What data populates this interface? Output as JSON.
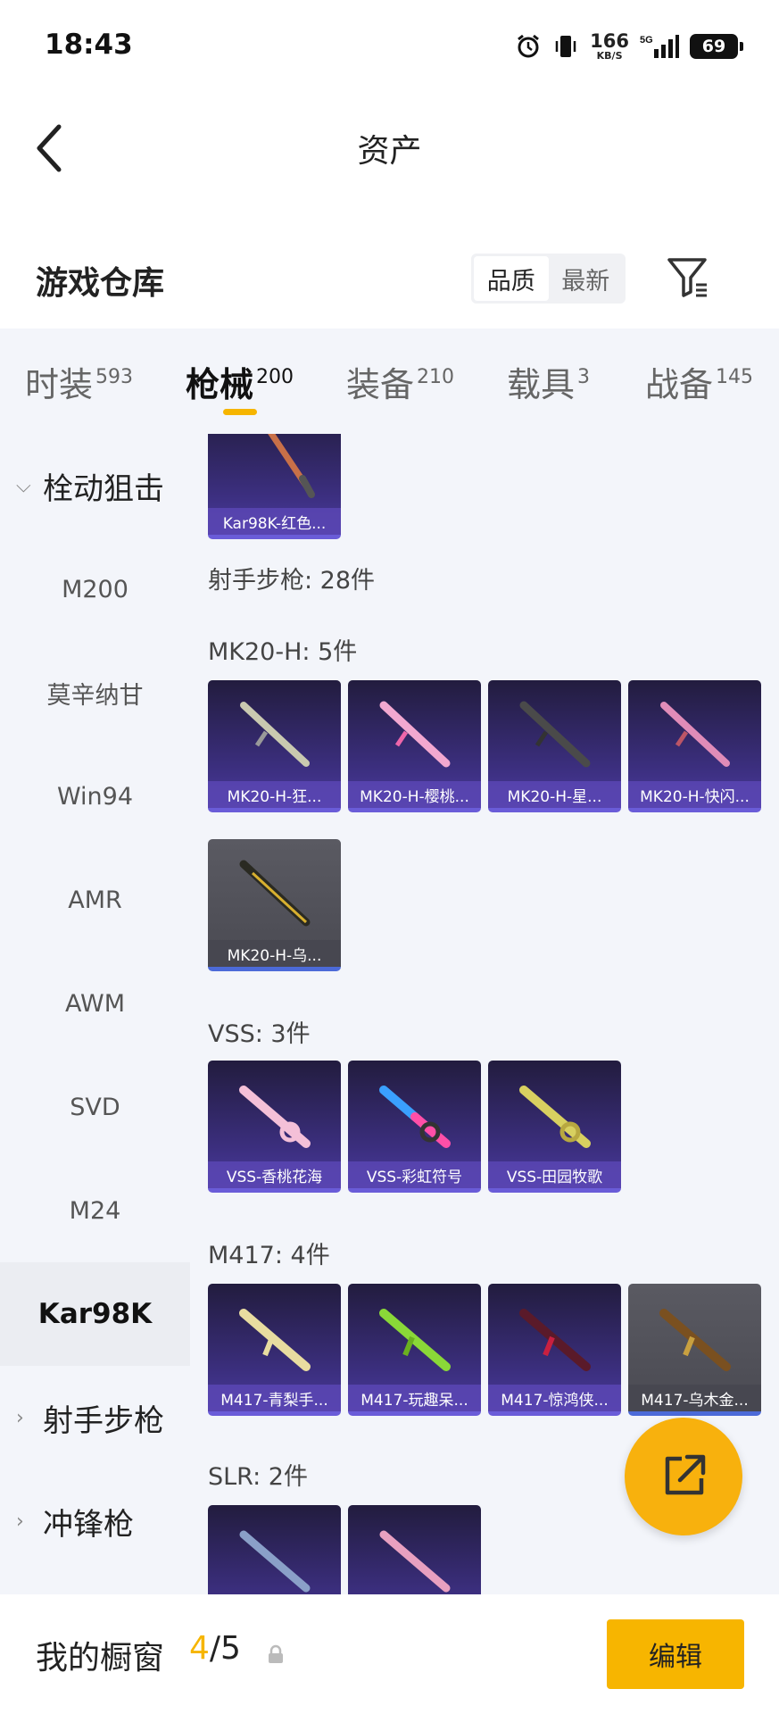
{
  "status_bar": {
    "time": "18:43",
    "net_speed": "166",
    "net_unit": "KB/S",
    "network": "5G",
    "battery": "69"
  },
  "header": {
    "title": "资产"
  },
  "warehouse": {
    "title": "游戏仓库",
    "sort_quality": "品质",
    "sort_newest": "最新"
  },
  "tabs": [
    {
      "label": "时装",
      "count": "593"
    },
    {
      "label": "枪械",
      "count": "200"
    },
    {
      "label": "装备",
      "count": "210"
    },
    {
      "label": "载具",
      "count": "3"
    },
    {
      "label": "战备",
      "count": "145"
    }
  ],
  "sidebar": {
    "group": "栓动狙击",
    "items": [
      "M200",
      "莫辛纳甘",
      "Win94",
      "AMR",
      "AWM",
      "SVD",
      "M24",
      "Kar98K"
    ],
    "group2": "射手步枪",
    "group3": "冲锋枪"
  },
  "sections": {
    "top_card": "Kar98K-红色...",
    "marksman": "射手步枪: 28件",
    "mk20": {
      "title": "MK20-H: 5件",
      "cards": [
        "MK20-H-狂...",
        "MK20-H-樱桃...",
        "MK20-H-星...",
        "MK20-H-快闪...",
        "MK20-H-乌..."
      ]
    },
    "vss": {
      "title": "VSS: 3件",
      "cards": [
        "VSS-香桃花海",
        "VSS-彩虹符号",
        "VSS-田园牧歌"
      ]
    },
    "m417": {
      "title": "M417: 4件",
      "cards": [
        "M417-青梨手...",
        "M417-玩趣呆...",
        "M417-惊鸿侠...",
        "M417-乌木金..."
      ]
    },
    "slr": {
      "title": "SLR: 2件"
    }
  },
  "bottom": {
    "label": "我的橱窗",
    "count_active": "4",
    "count_total": "/5",
    "edit": "编辑"
  }
}
